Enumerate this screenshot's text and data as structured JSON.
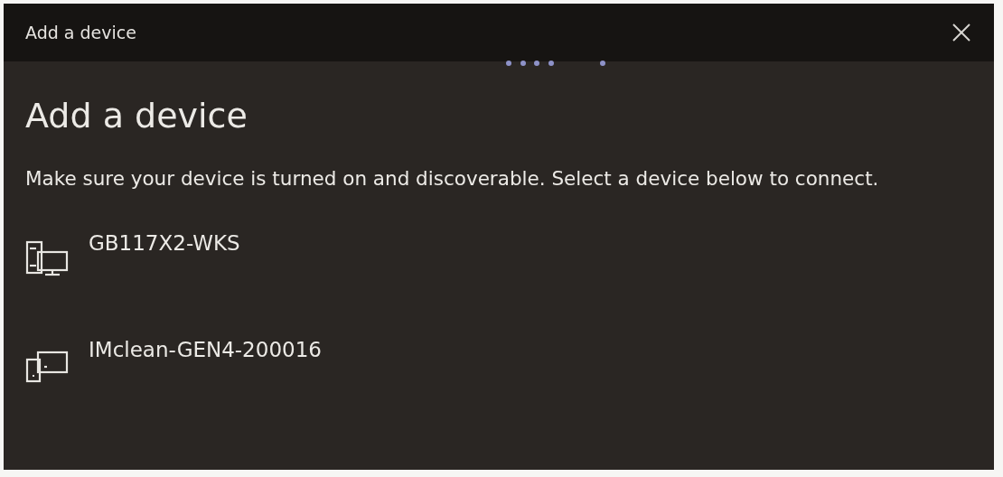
{
  "window": {
    "title": "Add a device"
  },
  "heading": "Add a device",
  "instructions": "Make sure your device is turned on and discoverable. Select a device below to connect.",
  "devices": [
    {
      "name": "GB117X2-WKS",
      "kind": "computer"
    },
    {
      "name": "IMclean-GEN4-200016",
      "kind": "display"
    }
  ]
}
